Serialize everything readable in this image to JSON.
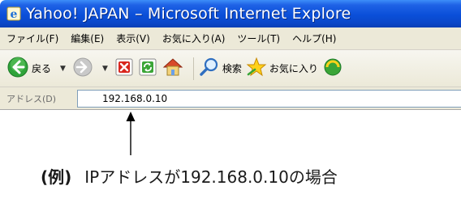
{
  "window": {
    "title": "Yahoo! JAPAN – Microsoft Internet Explore"
  },
  "menu": {
    "items": [
      "ファイル(F)",
      "編集(E)",
      "表示(V)",
      "お気に入り(A)",
      "ツール(T)",
      "ヘルプ(H)"
    ]
  },
  "toolbar": {
    "back_label": "戻る",
    "search_label": "検索",
    "favorites_label": "お気に入り"
  },
  "address": {
    "label": "アドレス(D)",
    "value": "192.168.0.10"
  },
  "annotation": {
    "prefix": "(例)",
    "text": "IPアドレスが192.168.0.10の場合"
  },
  "colors": {
    "titlebar": "#0a4fd9",
    "chrome": "#ece9d8",
    "back_green": "#2fa33a",
    "stop_red": "#d8251c",
    "refresh_green": "#3aa537"
  },
  "icons": [
    "ie-logo-icon",
    "back-arrow-icon",
    "forward-arrow-icon",
    "stop-icon",
    "refresh-icon",
    "home-icon",
    "search-magnifier-icon",
    "favorites-star-icon",
    "media-icon"
  ]
}
